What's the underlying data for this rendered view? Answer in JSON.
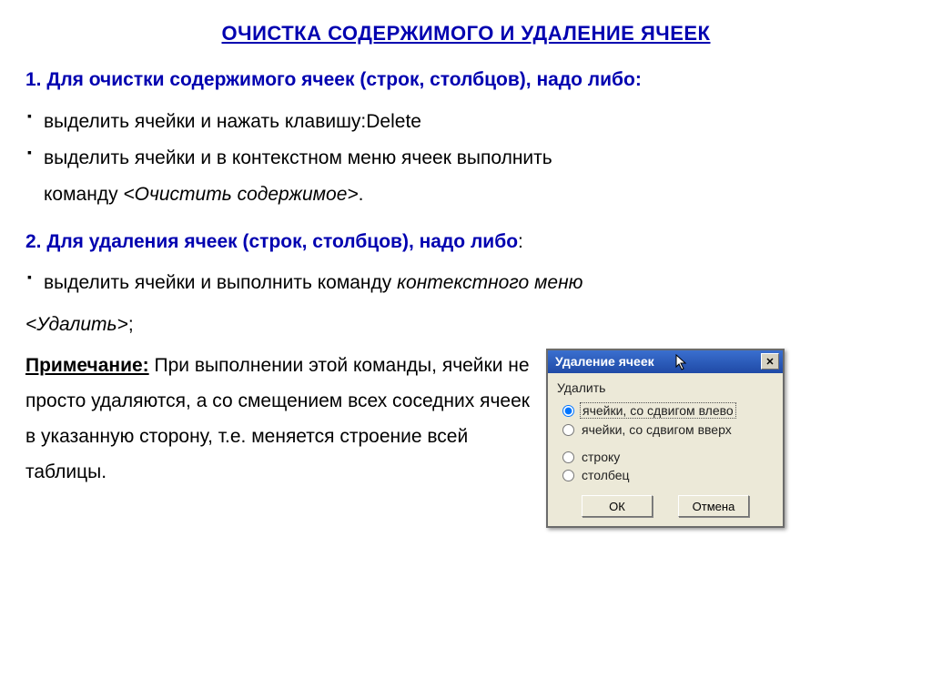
{
  "title": "ОЧИСТКА СОДЕРЖИМОГО И УДАЛЕНИЕ ЯЧЕЕК",
  "section1": {
    "num": "1. ",
    "lead": "Для очистки содержимого ячеек (строк, столбцов), надо либо:",
    "bullet1": "выделить ячейки и нажать клавишу:Delete",
    "bullet2_a": "выделить ячейки и в контекстном меню ячеек выполнить",
    "bullet2_b": "команду ",
    "bullet2_cmd": "<Очистить содержимое>",
    "bullet2_c": "."
  },
  "section2": {
    "num": "2.  ",
    "lead": "Для удаления ячеек (строк, столбцов), надо либо",
    "colon": ":",
    "bullet1_a": "выделить ячейки и выполнить команду ",
    "bullet1_b": "контекстного меню",
    "delete_cmd": "<Удалить>",
    "semicolon": ";"
  },
  "note": {
    "label": "Примечание:",
    "text": " При выполнении этой команды, ячейки не просто удаляются, а со смещением всех соседних ячеек в указанную сторону, т.е. меняется строение всей таблицы."
  },
  "dialog": {
    "title": "Удаление ячеек",
    "close_glyph": "✕",
    "label": "Удалить",
    "options": {
      "shift_left": "ячейки, со сдвигом влево",
      "shift_up": "ячейки, со сдвигом вверх",
      "row": "строку",
      "column": "столбец"
    },
    "ok": "ОК",
    "cancel": "Отмена"
  }
}
